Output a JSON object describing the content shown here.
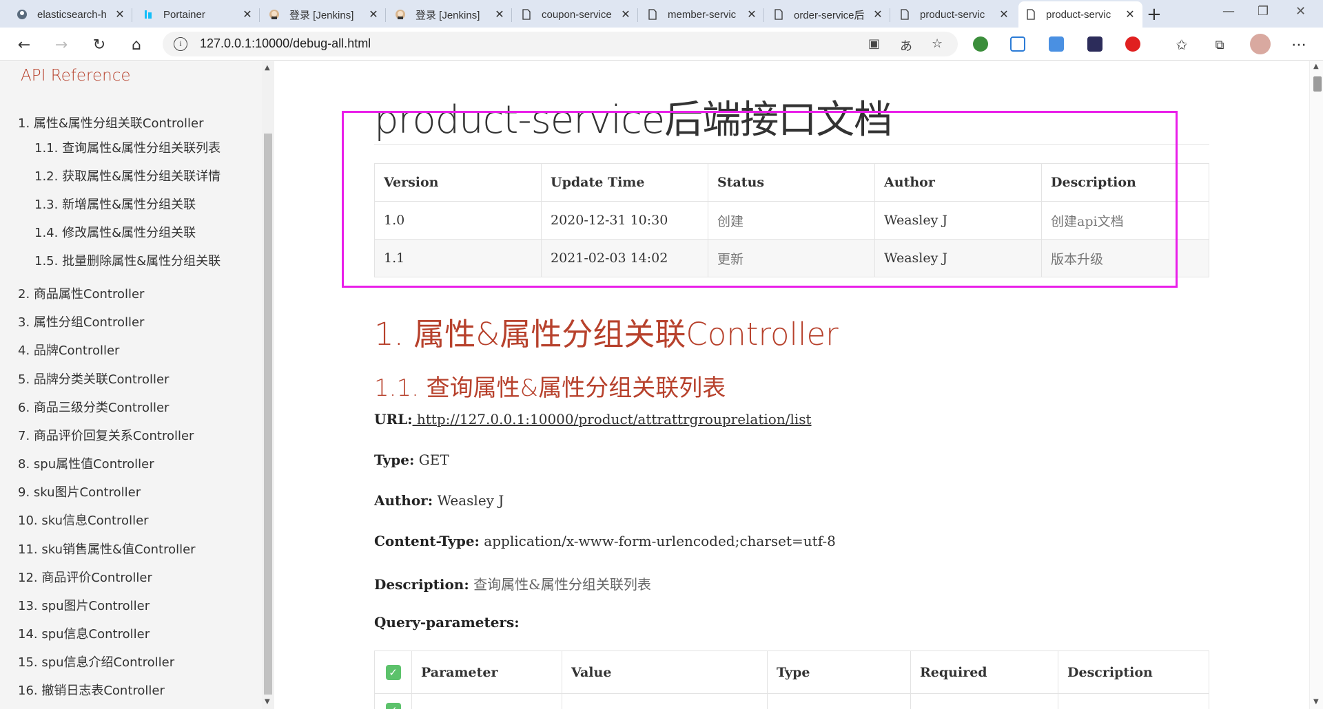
{
  "browser": {
    "tabs": [
      {
        "title": "elasticsearch-h",
        "icon": "elasticsearch-favicon"
      },
      {
        "title": "Portainer",
        "icon": "portainer-favicon"
      },
      {
        "title": "登录 [Jenkins]",
        "icon": "jenkins-favicon"
      },
      {
        "title": "登录 [Jenkins]",
        "icon": "jenkins-favicon"
      },
      {
        "title": "coupon-service",
        "icon": "page-icon"
      },
      {
        "title": "member-servic",
        "icon": "page-icon"
      },
      {
        "title": "order-service后",
        "icon": "page-icon"
      },
      {
        "title": "product-servic",
        "icon": "page-icon"
      },
      {
        "title": "product-servic",
        "icon": "page-icon"
      }
    ],
    "active_tab_index": 8,
    "new_tab": "+",
    "url": "127.0.0.1:10000/debug-all.html"
  },
  "sidebar": {
    "title": "API Reference",
    "items": [
      "1. 属性&属性分组关联Controller",
      "1.1. 查询属性&属性分组关联列表",
      "1.2. 获取属性&属性分组关联详情",
      "1.3. 新增属性&属性分组关联",
      "1.4. 修改属性&属性分组关联",
      "1.5. 批量删除属性&属性分组关联",
      "2. 商品属性Controller",
      "3. 属性分组Controller",
      "4. 品牌Controller",
      "5. 品牌分类关联Controller",
      "6. 商品三级分类Controller",
      "7. 商品评价回复关系Controller",
      "8. spu属性值Controller",
      "9. sku图片Controller",
      "10. sku信息Controller",
      "11. sku销售属性&值Controller",
      "12. 商品评价Controller",
      "13. spu图片Controller",
      "14. spu信息Controller",
      "15. spu信息介绍Controller",
      "16. 撤销日志表Controller"
    ]
  },
  "doc": {
    "title": "product-service后端接口文档",
    "version_table": {
      "headers": [
        "Version",
        "Update Time",
        "Status",
        "Author",
        "Description"
      ],
      "rows": [
        [
          "1.0",
          "2020-12-31 10:30",
          "创建",
          "Weasley J",
          "创建api文档"
        ],
        [
          "1.1",
          "2021-02-03 14:02",
          "更新",
          "Weasley J",
          "版本升级"
        ]
      ]
    },
    "h1": "1. 属性&属性分组关联Controller",
    "h2": "1.1. 查询属性&属性分组关联列表",
    "url_label": "URL:",
    "url_value": " http://127.0.0.1:10000/product/attrattrgrouprelation/list",
    "type_label": "Type:",
    "type_value": "GET",
    "author_label": "Author:",
    "author_value": "Weasley J",
    "content_type_label": "Content-Type:",
    "content_type_value": "application/x-www-form-urlencoded;charset=utf-8",
    "description_label": "Description:",
    "description_value": "查询属性&属性分组关联列表",
    "query_params_label": "Query-parameters:",
    "param_table": {
      "headers": [
        "Parameter",
        "Value",
        "Type",
        "Required",
        "Description"
      ]
    }
  },
  "colors": {
    "accent": "#b7412c",
    "highlight_box": "#e91ee9",
    "checkbox": "#5cc26b"
  }
}
